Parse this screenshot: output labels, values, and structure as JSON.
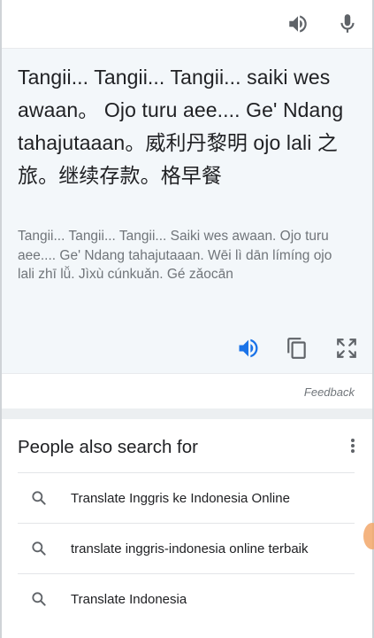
{
  "input_bar": {
    "speaker_icon": "volume-up-icon",
    "mic_icon": "microphone-icon"
  },
  "translation": {
    "output_text": "Tangii... Tangii... Tangii... saiki wes awaan。 Ojo turu aee.... Ge' Ndang tahajutaaan。威利丹黎明 ojo lali 之旅。继续存款。格早餐",
    "romanized_text": "Tangii... Tangii... Tangii... Saiki wes awaan. Ojo turu aee.... Ge' Ndang tahajutaaan. Wēi lì dān límíng ojo lali zhī lǚ. Jìxù cúnkuǎn. Gé zǎocān",
    "actions": [
      "listen",
      "copy",
      "fullscreen"
    ],
    "accent_color": "#1a73e8"
  },
  "feedback": {
    "label": "Feedback"
  },
  "people_also_search": {
    "title": "People also search for",
    "items": [
      {
        "label": "Translate Inggris ke Indonesia Online"
      },
      {
        "label": "translate inggris-indonesia online terbaik"
      },
      {
        "label": "Translate Indonesia"
      }
    ]
  }
}
